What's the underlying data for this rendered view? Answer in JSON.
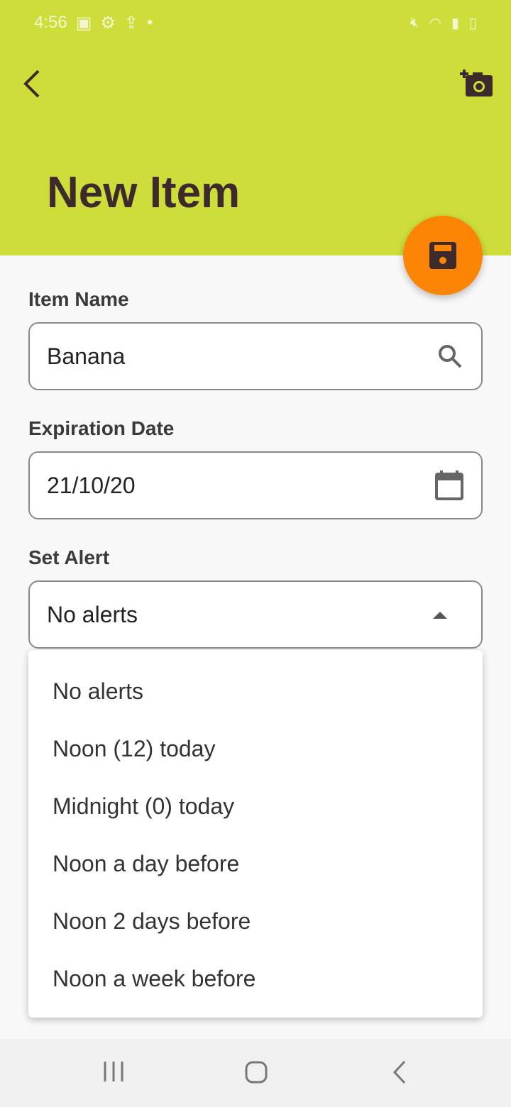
{
  "status": {
    "time": "4:56"
  },
  "header": {
    "title": "New Item",
    "accent": "#cddd3a",
    "fab_color": "#fd8505"
  },
  "form": {
    "item_name": {
      "label": "Item Name",
      "value": "Banana"
    },
    "expiration": {
      "label": "Expiration Date",
      "value": "21/10/20"
    },
    "alert": {
      "label": "Set Alert",
      "value": "No alerts",
      "options": [
        "No alerts",
        "Noon (12) today",
        "Midnight (0) today",
        "Noon a day before",
        "Noon 2 days before",
        "Noon a week before"
      ]
    }
  }
}
